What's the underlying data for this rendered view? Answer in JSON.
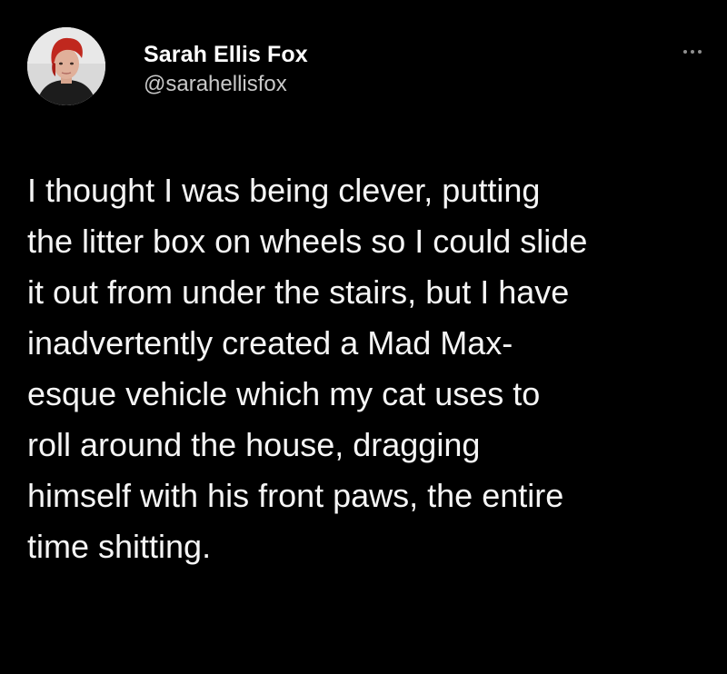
{
  "author": {
    "display_name": "Sarah Ellis Fox",
    "handle": "@sarahellisfox"
  },
  "icons": {
    "more": "more-options-icon",
    "avatar": "profile-avatar"
  },
  "tweet": {
    "lines": [
      "I thought I was being clever, putting",
      "the litter box on wheels so I could slide",
      "it out from under the stairs, but I have",
      "inadvertently created a Mad Max-",
      "esque vehicle which my cat uses to",
      "roll around the house, dragging",
      "himself with his front paws, the entire",
      "time shitting."
    ]
  },
  "colors": {
    "background": "#000000",
    "text": "#ffffff",
    "handle": "#c9c9c9",
    "icon": "#8f8f8f"
  }
}
